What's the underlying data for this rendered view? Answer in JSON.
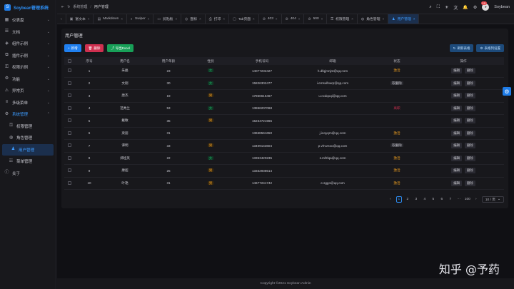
{
  "app": {
    "title": "Soybean管理系统",
    "logo_glyph": "S"
  },
  "sidebar": {
    "items": [
      {
        "label": "仪表盘",
        "icon": "▦",
        "chev": "⌄"
      },
      {
        "label": "文档",
        "icon": "☰",
        "chev": "⌄"
      },
      {
        "label": "组件示例",
        "icon": "◈",
        "chev": "⌄"
      },
      {
        "label": "插件示例",
        "icon": "⧉",
        "chev": "⌄"
      },
      {
        "label": "权限示例",
        "icon": "⚿",
        "chev": "⌄"
      },
      {
        "label": "功能",
        "icon": "⚙",
        "chev": "⌄"
      },
      {
        "label": "异常页",
        "icon": "⚠",
        "chev": "⌄"
      },
      {
        "label": "多级菜单",
        "icon": "≡",
        "chev": "⌄"
      },
      {
        "label": "系统管理",
        "icon": "⚙",
        "chev": "⌃"
      },
      {
        "label": "权限管理",
        "icon": "⚿"
      },
      {
        "label": "角色管理",
        "icon": "◍"
      },
      {
        "label": "用户管理",
        "icon": "♟"
      },
      {
        "label": "菜单管理",
        "icon": "☷"
      },
      {
        "label": "关于",
        "icon": "ⓘ"
      }
    ]
  },
  "header": {
    "crumbs": [
      "系统管理",
      "用户管理"
    ],
    "fold_icon": "⇤",
    "refresh_icon": "↻",
    "search_icon": "⌕",
    "fullscreen_icon": "⛶",
    "theme_icon": "☀",
    "lang_icon": "文",
    "bell_icon": "🔔",
    "notify_count": "10",
    "gear_icon": "⚙",
    "username": "Soybean"
  },
  "tabs": [
    {
      "label": "",
      "icon": "‹"
    },
    {
      "label": "富文本",
      "icon": "▣"
    },
    {
      "label": "Markdown",
      "icon": "▤"
    },
    {
      "label": "Swiper",
      "icon": "◐"
    },
    {
      "label": "剪贴板",
      "icon": "▭"
    },
    {
      "label": "图标",
      "icon": "◎"
    },
    {
      "label": "打印",
      "icon": "⎙"
    },
    {
      "label": "Tab页面",
      "icon": "▢"
    },
    {
      "label": "403",
      "icon": "⊘"
    },
    {
      "label": "404",
      "icon": "⊘"
    },
    {
      "label": "500",
      "icon": "⊘"
    },
    {
      "label": "权限管理",
      "icon": "⚿"
    },
    {
      "label": "角色管理",
      "icon": "◍"
    },
    {
      "label": "用户管理",
      "icon": "♟"
    }
  ],
  "card": {
    "title": "用户管理"
  },
  "toolbar": {
    "add": "新增",
    "delete": "删除",
    "export": "导出Excel",
    "refresh": "刷新表格",
    "columns": "表格列设置"
  },
  "table": {
    "headers": [
      "序号",
      "用户名",
      "用户年龄",
      "性别",
      "手机号码",
      "邮箱",
      "状态",
      "操作"
    ],
    "edit_label": "编辑",
    "delete_label": "删除",
    "rows": [
      {
        "no": "1",
        "name": "朱磊",
        "age": "23",
        "gender": "女",
        "phone": "14077232427",
        "email": "h.dfqjmnjnt@qq.com",
        "status": "激活"
      },
      {
        "no": "2",
        "name": "文刚",
        "age": "30",
        "gender": "女",
        "phone": "15826302477",
        "email": "i.emsulhwqr@qq.com",
        "status": "软删除"
      },
      {
        "no": "3",
        "name": "唐杰",
        "age": "19",
        "gender": "男",
        "phone": "17856616467",
        "email": "u.cxdqxqi@qq.com",
        "status": ""
      },
      {
        "no": "4",
        "name": "范秀兰",
        "age": "53",
        "gender": "女",
        "phone": "13866207068",
        "email": "",
        "status": "离职"
      },
      {
        "no": "5",
        "name": "戴敏",
        "age": "35",
        "gender": "男",
        "phone": "15234721965",
        "email": "",
        "status": ""
      },
      {
        "no": "6",
        "name": "梁丽",
        "age": "31",
        "gender": "",
        "phone": "13658561650",
        "email": "j.iooyqm@qq.com",
        "status": "激活"
      },
      {
        "no": "7",
        "name": "谭明",
        "age": "33",
        "gender": "男",
        "phone": "13409143604",
        "email": "p.vhvvnoo@qq.com",
        "status": "软删除"
      },
      {
        "no": "8",
        "name": "郑桂英",
        "age": "22",
        "gender": "女",
        "phone": "13353420235",
        "email": "s.mfzlqa@qq.com",
        "status": "激活"
      },
      {
        "no": "9",
        "name": "康超",
        "age": "25",
        "gender": "男",
        "phone": "13332938514",
        "email": "",
        "status": "激活"
      },
      {
        "no": "10",
        "name": "叶艳",
        "age": "31",
        "gender": "男",
        "phone": "14677241742",
        "email": "e.sggo@qq.com",
        "status": "激活"
      }
    ]
  },
  "pagination": {
    "prev": "‹",
    "next": "›",
    "pages": [
      "1",
      "2",
      "3",
      "4",
      "5",
      "6",
      "7",
      "···",
      "100"
    ],
    "current": "1",
    "page_size": "10 / 页"
  },
  "footer": {
    "copyright": "Copyright ©2021 Soybean Admin"
  },
  "watermark": "知乎 @予药",
  "colors": {
    "accent": "#2080f0",
    "danger": "#d03050",
    "success": "#18a058",
    "warning": "#f0a020",
    "bg": "#101014",
    "panel": "#18181c"
  }
}
